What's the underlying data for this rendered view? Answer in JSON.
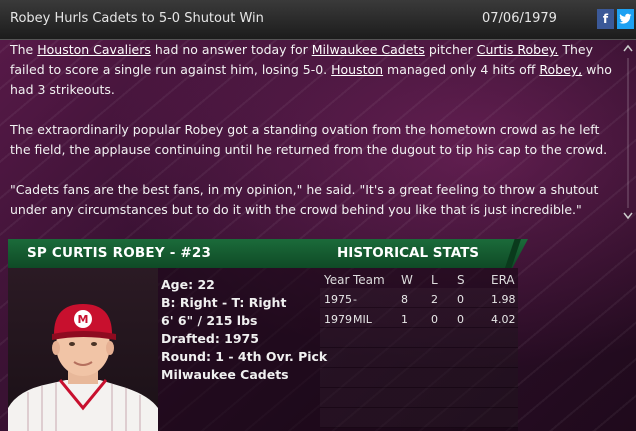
{
  "header": {
    "headline": "Robey Hurls Cadets to 5-0 Shutout Win",
    "date": "07/06/1979",
    "facebook_label": "f",
    "twitter_label": "t"
  },
  "article": {
    "p1": {
      "t1": "The ",
      "team1": "Houston Cavaliers",
      "t2": " had no answer today for ",
      "team2": "Milwaukee Cadets",
      "t3": " pitcher ",
      "player": "Curtis Robey.",
      "t4": " They failed to score a single run against him, losing 5-0. ",
      "team1_short": "Houston",
      "t5": " managed only 4 hits off ",
      "player_short": "Robey,",
      "t6": " who had 3 strikeouts."
    },
    "p2": "The extraordinarily popular Robey got a standing ovation from the hometown crowd as he left the field, the applause continuing until he returned from the dugout to tip his cap to the crowd.",
    "p3": "\"Cadets fans are the best fans, in my opinion,\" he said. \"It's a great feeling to throw a shutout under any circumstances but to do it with the crowd behind you like that is just incredible.\""
  },
  "player": {
    "banner_name": "SP CURTIS ROBEY - #23",
    "age": "Age: 22",
    "bats_throws": "B: Right - T: Right",
    "height_weight": "6' 6\" / 215 lbs",
    "drafted": "Drafted: 1975",
    "round": "Round: 1 - 4th Ovr. Pick",
    "team": "Milwaukee Cadets"
  },
  "historical": {
    "title": "HISTORICAL STATS",
    "columns": [
      "Year",
      "Team",
      "W",
      "L",
      "S",
      "ERA"
    ],
    "rows": [
      {
        "year": "1975",
        "team": "-",
        "w": "8",
        "l": "2",
        "s": "0",
        "era": "1.98"
      },
      {
        "year": "1979",
        "team": "MIL",
        "w": "1",
        "l": "0",
        "s": "0",
        "era": "4.02"
      }
    ]
  },
  "colors": {
    "banner": "#1b6b3a",
    "header": "#2a2a2a",
    "background": "#3b1234",
    "cap": "#c8102e"
  }
}
